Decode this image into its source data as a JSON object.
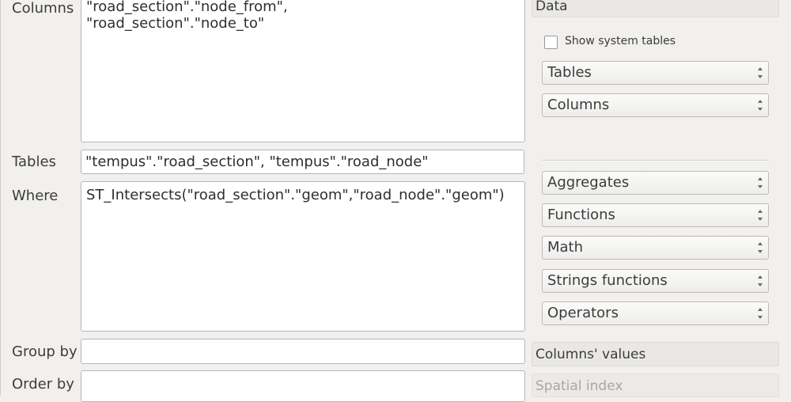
{
  "labels": {
    "columns": "Columns",
    "tables": "Tables",
    "where": "Where",
    "group_by": "Group by",
    "order_by": "Order by"
  },
  "fields": {
    "columns_lines": [
      "\"road_section\".\"node_from\",",
      "\"road_section\".\"node_to\""
    ],
    "tables_value": "\"tempus\".\"road_section\", \"tempus\".\"road_node\"",
    "where_value": "ST_Intersects(\"road_section\".\"geom\",\"road_node\".\"geom\")",
    "group_by_value": "",
    "order_by_value": ""
  },
  "right_panel": {
    "data_header": "Data",
    "show_system_tables_label": "Show system tables",
    "show_system_tables_checked": false,
    "tables_combo": "Tables",
    "columns_combo": "Columns",
    "aggregates_combo": "Aggregates",
    "functions_combo": "Functions",
    "math_combo": "Math",
    "strings_combo": "Strings functions",
    "operators_combo": "Operators",
    "columns_values_header": "Columns' values",
    "spatial_index_header": "Spatial index"
  }
}
